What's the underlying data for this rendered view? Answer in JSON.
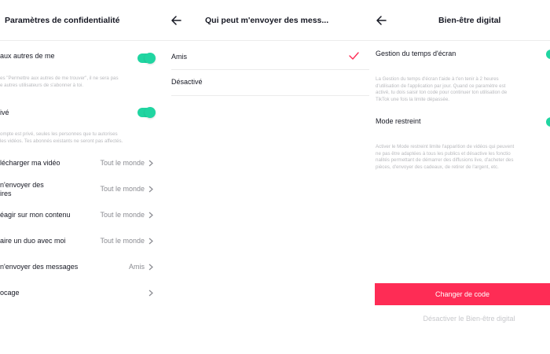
{
  "privacy": {
    "title": "Paramètres de confidentialité",
    "suggest": {
      "label": "aux autres de me",
      "desc": [
        "es \"Permettre aux autres de me trouver\", il ne sera pas",
        "e autres utilisateurs de s'abonner à toi."
      ]
    },
    "private": {
      "label": "ivé",
      "desc": [
        "ompte est privé, seules les personnes que tu autorises",
        "les vidéos. Tes abonnés existants ne seront pas affectés."
      ]
    },
    "rows": [
      {
        "label": "lécharger ma vidéo",
        "value": "Tout le monde"
      },
      {
        "label": "n'envoyer des",
        "label2": "ires",
        "value": "Tout le monde"
      },
      {
        "label": "éagir sur mon contenu",
        "value": "Tout le monde"
      },
      {
        "label": "aire un duo avec moi",
        "value": "Tout le monde"
      },
      {
        "label": "n'envoyer des messages",
        "value": "Amis"
      },
      {
        "label": "ocage",
        "value": ""
      }
    ]
  },
  "messages": {
    "title": "Qui peut m'envoyer des mess...",
    "options": [
      {
        "label": "Amis",
        "selected": true
      },
      {
        "label": "Désactivé",
        "selected": false
      }
    ],
    "check_color": "#fe2c55"
  },
  "wellbeing": {
    "title": "Bien-être digital",
    "screen_time": {
      "label": "Gestion du temps d'écran",
      "desc": [
        "La Gestion du temps d'écran t'aide à t'en tenir à 2 heures",
        "d'utilisation de l'application par jour. Quand ce paramètre est",
        "activé, tu dois saisir ton code pour continuer ton utilisation de",
        "TikTok une fois la limite dépassée."
      ]
    },
    "restricted": {
      "label": "Mode restreint",
      "desc": [
        "Activer le Mode restreint limite l'apparition de vidéos qui peuvent",
        "ne pas être adaptées à tous les publics et désactive les fonctio",
        "nalités permettant de démarrer des diffusions live, d'acheter des",
        "pièces, d'envoyer des cadeaux, de retirer de l'argent, etc."
      ]
    },
    "change_code": "Changer de code",
    "deactivate": "Désactiver le Bien-être digital"
  },
  "colors": {
    "accent": "#fe2c55",
    "toggle_on": "#20d5a1"
  }
}
